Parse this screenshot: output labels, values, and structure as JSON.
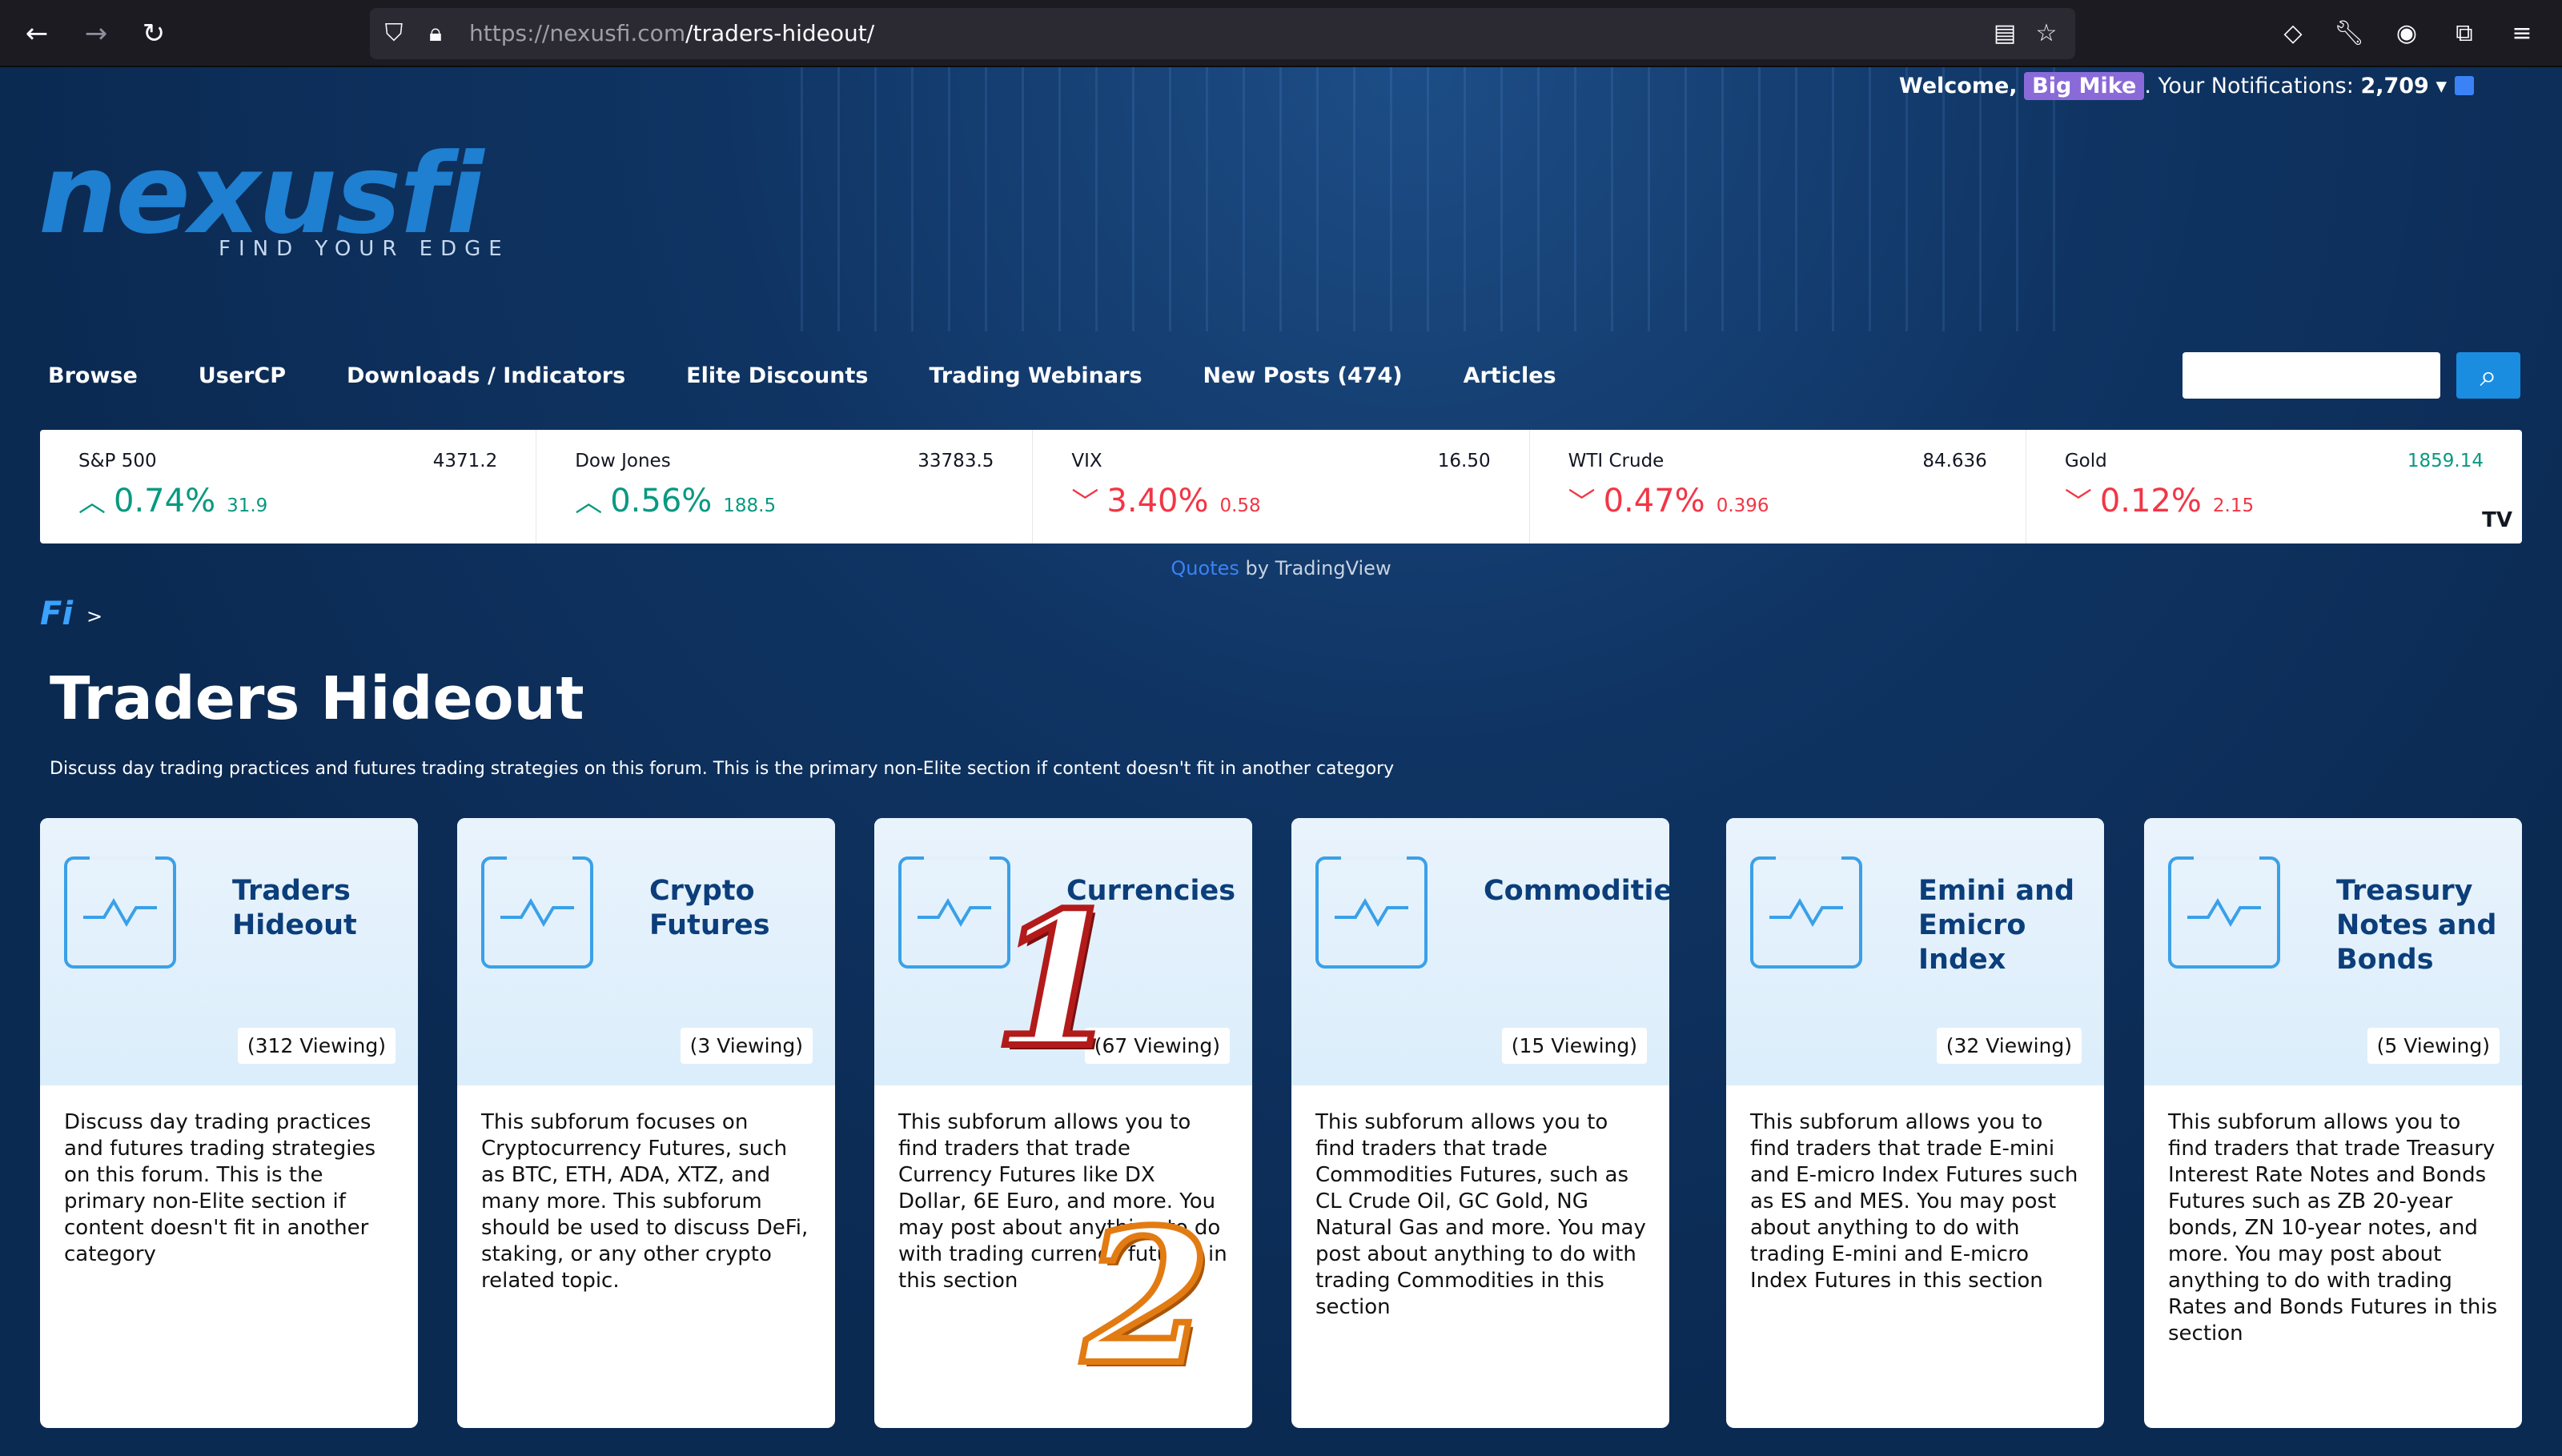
{
  "browser": {
    "url_host": "https://nexusfi.com",
    "url_path": "/traders-hideout/"
  },
  "header": {
    "welcome_prefix": "Welcome,",
    "username": "Big Mike",
    "notifications_label": ". Your Notifications:",
    "notifications_count": "2,709",
    "logo_text": "nexusfi",
    "logo_tagline": "FIND YOUR EDGE"
  },
  "nav": {
    "items": [
      "Browse",
      "UserCP",
      "Downloads / Indicators",
      "Elite Discounts",
      "Trading Webinars",
      "New Posts (474)",
      "Articles"
    ]
  },
  "ticker": [
    {
      "name": "S&P 500",
      "price": "4371.2",
      "pct": "0.74%",
      "chg": "31.9",
      "dir": "up"
    },
    {
      "name": "Dow Jones",
      "price": "33783.5",
      "pct": "0.56%",
      "chg": "188.5",
      "dir": "up"
    },
    {
      "name": "VIX",
      "price": "16.50",
      "pct": "3.40%",
      "chg": "0.58",
      "dir": "down"
    },
    {
      "name": "WTI Crude",
      "price": "84.636",
      "pct": "0.47%",
      "chg": "0.396",
      "dir": "down"
    },
    {
      "name": "Gold",
      "price": "1859.14",
      "pct": "0.12%",
      "chg": "2.15",
      "dir": "down"
    }
  ],
  "ticker_brand": "TV",
  "quotes": {
    "link": "Quotes",
    "suffix": " by TradingView"
  },
  "breadcrumb": {
    "logo": "Fi",
    "sep": ">"
  },
  "page": {
    "title": "Traders Hideout",
    "description": "Discuss day trading practices and futures trading strategies on this forum. This is the primary non-Elite section if content doesn't fit in another category"
  },
  "cards": [
    {
      "title": "Traders Hideout",
      "viewing": "(312 Viewing)",
      "body": "Discuss day trading practices and futures trading strategies on this forum. This is the primary non-Elite section if content doesn't fit in another category"
    },
    {
      "title": "Crypto Futures",
      "viewing": "(3 Viewing)",
      "body": "This subforum focuses on Cryptocurrency Futures, such as BTC, ETH, ADA, XTZ, and many more. This subforum should be used to discuss DeFi, staking, or any other crypto related topic."
    },
    {
      "title": "Currencies",
      "viewing": "(67 Viewing)",
      "body": "This subforum allows you to find traders that trade Currency Futures like DX Dollar, 6E Euro, and more. You may post about anything to do with trading currency futures in this section"
    },
    {
      "title": "Commodities",
      "viewing": "(15 Viewing)",
      "body": "This subforum allows you to find traders that trade Commodities Futures, such as CL Crude Oil, GC Gold, NG Natural Gas and more. You may post about anything to do with trading Commodities in this section"
    },
    {
      "title": "Emini and Emicro Index",
      "viewing": "(32 Viewing)",
      "body": "This subforum allows you to find traders that trade E-mini and E-micro Index Futures such as ES and MES. You may post about anything to do with trading E-mini and E-micro Index Futures in this section"
    },
    {
      "title": "Treasury Notes and Bonds",
      "viewing": "(5 Viewing)",
      "body": "This subforum allows you to find traders that trade Treasury Interest Rate Notes and Bonds Futures such as ZB 20-year bonds, ZN 10-year notes, and more. You may post about anything to do with trading Rates and Bonds Futures in this section"
    }
  ],
  "annotations": {
    "one": "1",
    "two": "2"
  },
  "colors": {
    "accent": "#1a8de0",
    "up": "#089981",
    "down": "#f23645",
    "background": "#0b2a52"
  }
}
